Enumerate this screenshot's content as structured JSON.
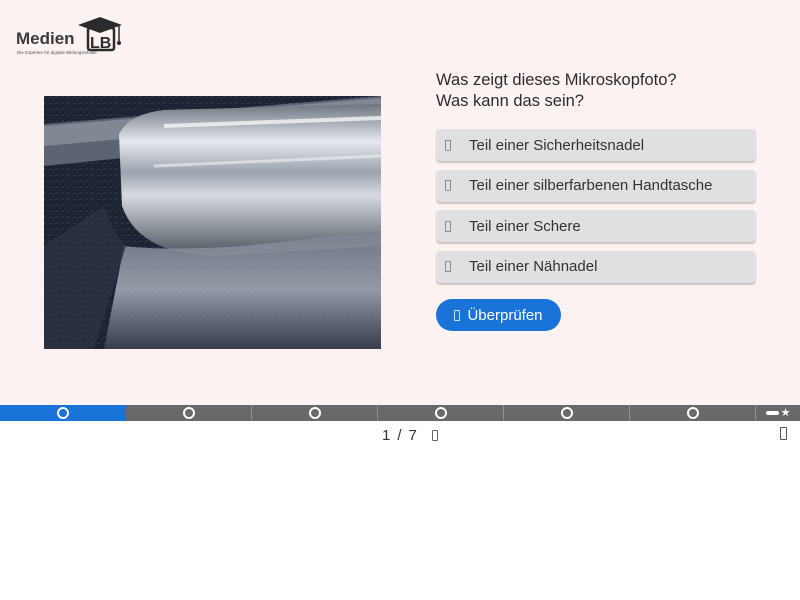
{
  "logo": {
    "alt": "MedienLB",
    "wordmark": "Medien",
    "mark": "LB",
    "tagline": "Die Experten für digitale Bildungsinhalte"
  },
  "question": {
    "line1": "Was zeigt dieses Mikroskopfoto?",
    "line2": "Was kann das sein?"
  },
  "answers": [
    {
      "label": "Teil einer Sicherheitsnadel",
      "icon": "radio-unchecked-icon"
    },
    {
      "label": "Teil einer silberfarbenen Handtasche",
      "icon": "radio-unchecked-icon"
    },
    {
      "label": "Teil einer Schere",
      "icon": "radio-unchecked-icon"
    },
    {
      "label": "Teil einer Nähnadel",
      "icon": "radio-unchecked-icon"
    }
  ],
  "check_button": {
    "label": "Überprüfen",
    "icon": "check-icon"
  },
  "progress": {
    "total": 7,
    "current": 1,
    "final_icon": "summary-star-icon"
  },
  "pager": {
    "current": "1",
    "separator": "/",
    "total": "7"
  },
  "colors": {
    "accent": "#1a73d9",
    "stage_bg": "#fcf2f1",
    "answer_bg": "#e0e0e0",
    "progress_bg": "#696969"
  }
}
